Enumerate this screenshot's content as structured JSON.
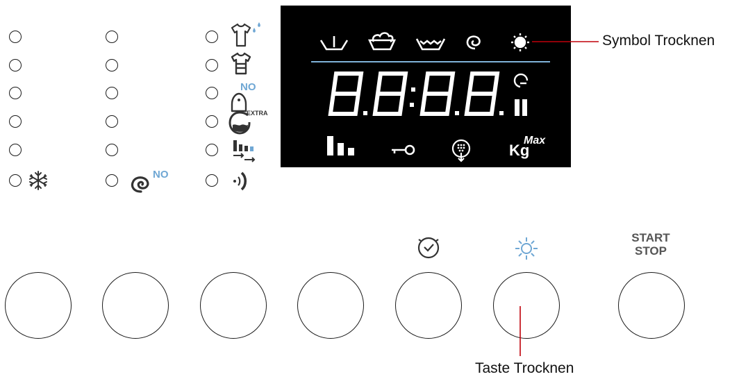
{
  "annotations": {
    "dry_symbol": "Symbol Trocknen",
    "dry_button": "Taste Trocknen"
  },
  "badges": {
    "no_iron": "NO",
    "no_spin": "NO",
    "extra_rinse": "EXTRA",
    "max_load": "Max",
    "kg": "Kg"
  },
  "display": {
    "digits": "8.8:8.8.",
    "symbols": [
      "prewash-icon",
      "wash-icon",
      "rinse-icon",
      "spin-icon",
      "dry-icon"
    ],
    "bottom_symbols": [
      "load-bars-icon",
      "child-lock-icon",
      "drain-icon",
      "max-load-icon"
    ]
  },
  "buttons": {
    "start_stop_line1": "START",
    "start_stop_line2": "STOP",
    "timer_icon": "clock-icon",
    "dry_icon": "sun-icon"
  },
  "colors": {
    "accent_blue": "#6fa7d4",
    "display_bg": "#000000",
    "display_fg": "#ffffff",
    "callout_line": "#c0000a"
  }
}
